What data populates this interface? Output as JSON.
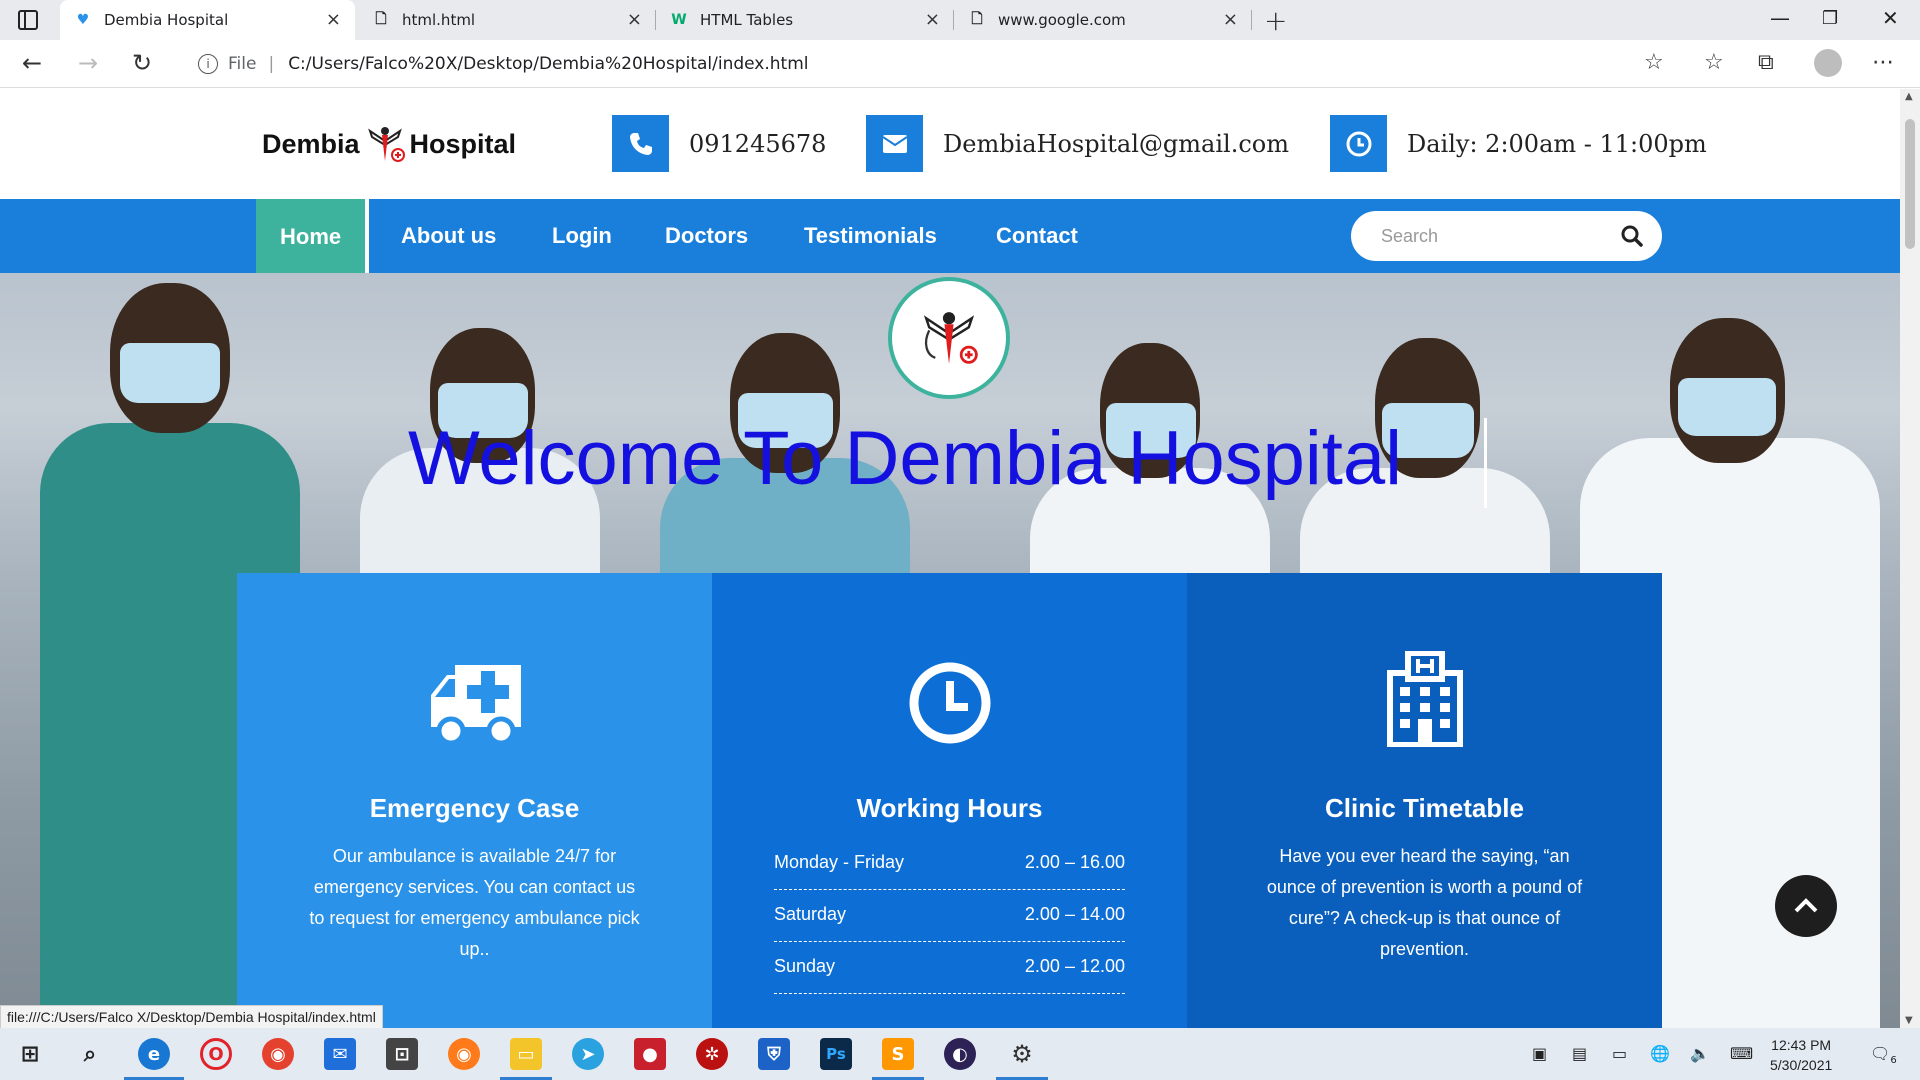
{
  "browser": {
    "tabs": [
      {
        "title": "Dembia Hospital",
        "icon": "heart-favicon-icon",
        "active": true
      },
      {
        "title": "html.html",
        "icon": "file-icon",
        "active": false
      },
      {
        "title": "HTML Tables",
        "icon": "w3schools-icon",
        "active": false
      },
      {
        "title": "www.google.com",
        "icon": "file-icon",
        "active": false
      }
    ],
    "tab_close": "×",
    "new_tab": "+",
    "address": {
      "file_label": "File",
      "url": "C:/Users/Falco%20X/Desktop/Dembia%20Hospital/index.html"
    }
  },
  "site": {
    "logo": {
      "left": "Dembia",
      "right": "Hospital"
    },
    "contacts": {
      "phone": "091245678",
      "email": "DembiaHospital@gmail.com",
      "hours": "Daily: 2:00am - 11:00pm"
    },
    "nav": [
      "Home",
      "About us",
      "Login",
      "Doctors",
      "Testimonials",
      "Contact"
    ],
    "search_placeholder": "Search",
    "hero_title": "Welcome To Dembia Hospital",
    "cards": {
      "emergency": {
        "title": "Emergency Case",
        "text": "Our ambulance is available 24/7 for emergency services. You can contact us to request for emergency ambulance pick up.."
      },
      "working": {
        "title": "Working Hours",
        "rows": [
          {
            "day": "Monday - Friday",
            "time": "2.00 – 16.00"
          },
          {
            "day": "Saturday",
            "time": "2.00 – 14.00"
          },
          {
            "day": "Sunday",
            "time": "2.00 – 12.00"
          }
        ]
      },
      "clinic": {
        "title": "Clinic Timetable",
        "text": "Have you ever heard the saying, “an ounce of prevention is worth a pound of cure”? A check-up is that ounce of prevention."
      }
    },
    "colors": {
      "primary": "#1a7fdb",
      "accent": "#3db39e",
      "title": "#1410e0",
      "card1": "#2a92e8",
      "card2": "#0d6fd6",
      "card3": "#0a5fbd"
    }
  },
  "status_url": "file:///C:/Users/Falco X/Desktop/Dembia Hospital/index.html",
  "taskbar": {
    "time": "12:43 PM",
    "date": "5/30/2021",
    "notification_count": "6"
  }
}
